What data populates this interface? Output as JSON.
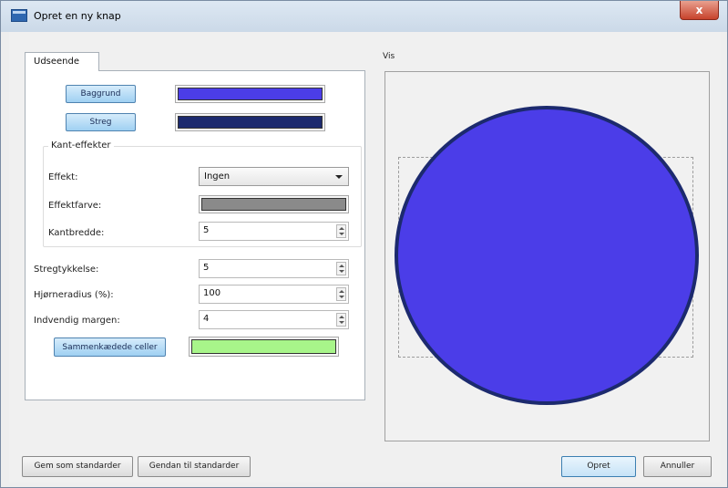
{
  "window": {
    "title": "Opret en ny knap",
    "close_glyph": "x"
  },
  "tabs": [
    {
      "label": "Udseende"
    }
  ],
  "appearance": {
    "background_button": "Baggrund",
    "background_color": "#4b3de8",
    "stroke_button": "Streg",
    "stroke_color": "#1c2a6e",
    "edge_effects": {
      "title": "Kant-effekter",
      "effect_label": "Effekt:",
      "effect_value": "Ingen",
      "effect_color_label": "Effektfarve:",
      "effect_color": "#8a8a8a",
      "edge_width_label": "Kantbredde:",
      "edge_width_value": "5"
    },
    "stroke_thickness_label": "Stregtykkelse:",
    "stroke_thickness_value": "5",
    "corner_radius_label": "Hjørneradius (%):",
    "corner_radius_value": "100",
    "inner_margin_label": "Indvendig margen:",
    "inner_margin_value": "4",
    "merged_cells_button": "Sammenkædede celler",
    "merged_cells_color": "#a8f58a"
  },
  "preview": {
    "label": "Vis"
  },
  "footer": {
    "save_default": "Gem som standarder",
    "restore_default": "Gendan til standarder",
    "create": "Opret",
    "cancel": "Annuller"
  },
  "colors": {
    "accent_button": "#9fd0f2"
  },
  "icons": {
    "app": "app-window-icon",
    "close": "close-icon",
    "dropdown": "chevron-down-icon",
    "spin": "spin-arrows-icon"
  }
}
